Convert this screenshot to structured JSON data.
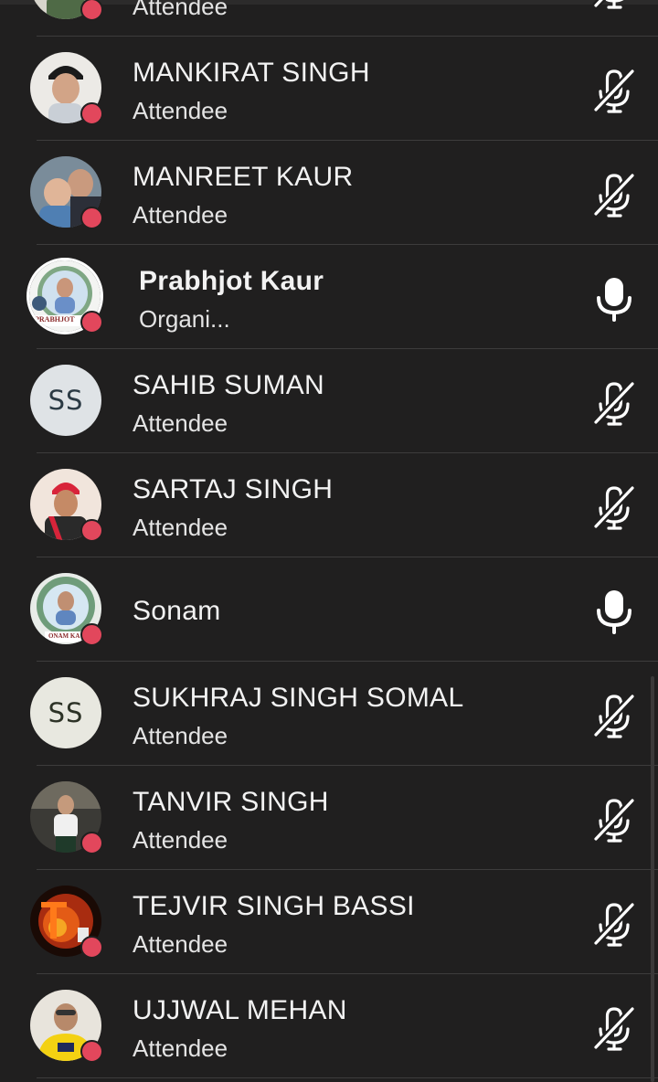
{
  "participants": [
    {
      "name": "",
      "role": "Attendee",
      "muted": true,
      "avatar": "photo-icon"
    },
    {
      "name": "MANKIRAT SINGH",
      "role": "Attendee",
      "muted": true,
      "avatar": "photo-icon"
    },
    {
      "name": "MANREET KAUR",
      "role": "Attendee",
      "muted": true,
      "avatar": "photo-icon"
    },
    {
      "name": "Prabhjot Kaur",
      "role": "Organi...",
      "muted": false,
      "avatar": "photo-icon",
      "avatar_caption": "PRABHJOT"
    },
    {
      "name": "SAHIB SUMAN",
      "role": "Attendee",
      "muted": true,
      "avatar_initials": "SS"
    },
    {
      "name": "SARTAJ SINGH",
      "role": "Attendee",
      "muted": true,
      "avatar": "photo-icon"
    },
    {
      "name": "Sonam",
      "role": "",
      "muted": false,
      "avatar": "photo-icon",
      "avatar_caption": "ONAM KA"
    },
    {
      "name": "SUKHRAJ SINGH SOMAL",
      "role": "Attendee",
      "muted": true,
      "avatar_initials": "SS"
    },
    {
      "name": "TANVIR SINGH",
      "role": "Attendee",
      "muted": true,
      "avatar": "photo-icon"
    },
    {
      "name": "TEJVIR SINGH BASSI",
      "role": "Attendee",
      "muted": true,
      "avatar": "photo-icon"
    },
    {
      "name": "UJJWAL MEHAN",
      "role": "Attendee",
      "muted": true,
      "avatar": "photo-icon"
    }
  ],
  "colors": {
    "background": "#201f1f",
    "status_dot": "#e2475c",
    "text": "#f2f2f2"
  }
}
